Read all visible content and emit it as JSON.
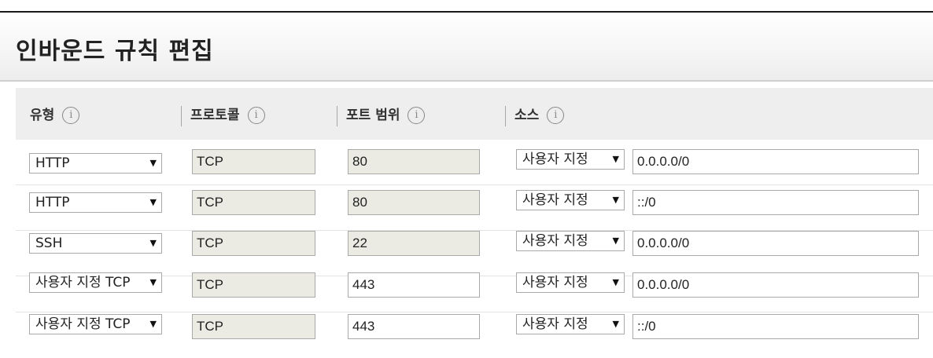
{
  "dialog": {
    "title": "인바운드 규칙 편집"
  },
  "columns": [
    {
      "label": "유형",
      "info": "i"
    },
    {
      "label": "프로토콜",
      "info": "i"
    },
    {
      "label": "포트 범위",
      "info": "i"
    },
    {
      "label": "소스",
      "info": "i"
    }
  ],
  "rules": [
    {
      "type": "HTTP",
      "protocol": "TCP",
      "port": "80",
      "port_readonly": true,
      "source_type": "사용자 지정",
      "source": "0.0.0.0/0"
    },
    {
      "type": "HTTP",
      "protocol": "TCP",
      "port": "80",
      "port_readonly": true,
      "source_type": "사용자 지정",
      "source": "::/0"
    },
    {
      "type": "SSH",
      "protocol": "TCP",
      "port": "22",
      "port_readonly": true,
      "source_type": "사용자 지정",
      "source": "0.0.0.0/0"
    },
    {
      "type": "사용자 지정 TCP",
      "protocol": "TCP",
      "port": "443",
      "port_readonly": false,
      "source_type": "사용자 지정",
      "source": "0.0.0.0/0"
    },
    {
      "type": "사용자 지정 TCP",
      "protocol": "TCP",
      "port": "443",
      "port_readonly": false,
      "source_type": "사용자 지정",
      "source": "::/0"
    }
  ],
  "icons": {
    "dropdown": "chevron-down-icon",
    "info": "info-circle-icon"
  },
  "colors": {
    "readonly_bg": "#ebebe4",
    "header_bg": "#eeeeee",
    "border": "#a9a9a9"
  }
}
